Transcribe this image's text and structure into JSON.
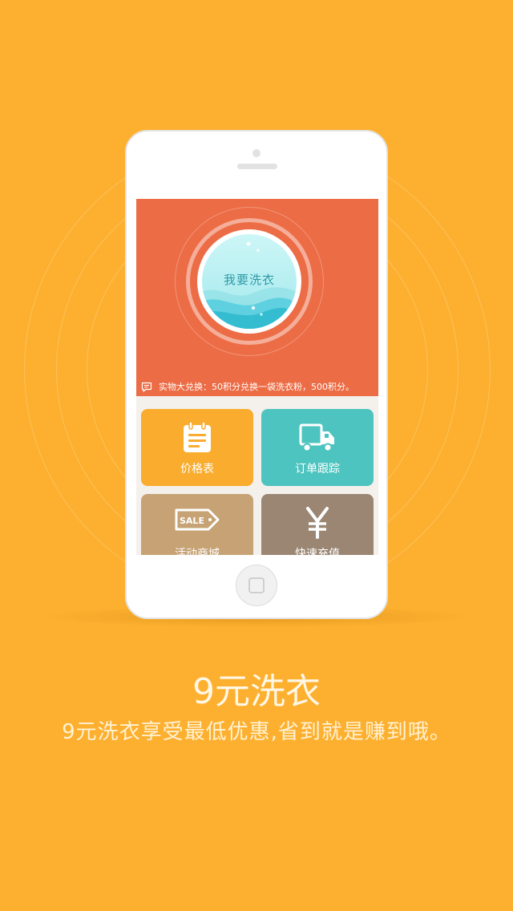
{
  "colors": {
    "background": "#fdb02f",
    "banner": "#ec6c45",
    "tile_price": "#f9ac2d",
    "tile_tracking": "#4dc4bf",
    "tile_mall": "#c6a275",
    "tile_recharge": "#9b8673",
    "water": "#5fd0df"
  },
  "phone": {
    "screen": {
      "wash_button": {
        "label": "我要洗衣"
      },
      "notice": {
        "icon": "message-icon",
        "text": "实物大兑换：50积分兑换一袋洗衣粉，500积分。"
      },
      "tiles": [
        {
          "label": "价格表",
          "icon": "calendar-icon"
        },
        {
          "label": "订单跟踪",
          "icon": "truck-icon"
        },
        {
          "label": "活动商城",
          "icon": "sale-tag-icon"
        },
        {
          "label": "快速充值",
          "icon": "yen-icon"
        }
      ]
    }
  },
  "headline": "9元洗衣",
  "subline": "9元洗衣享受最低优惠,省到就是赚到哦。"
}
